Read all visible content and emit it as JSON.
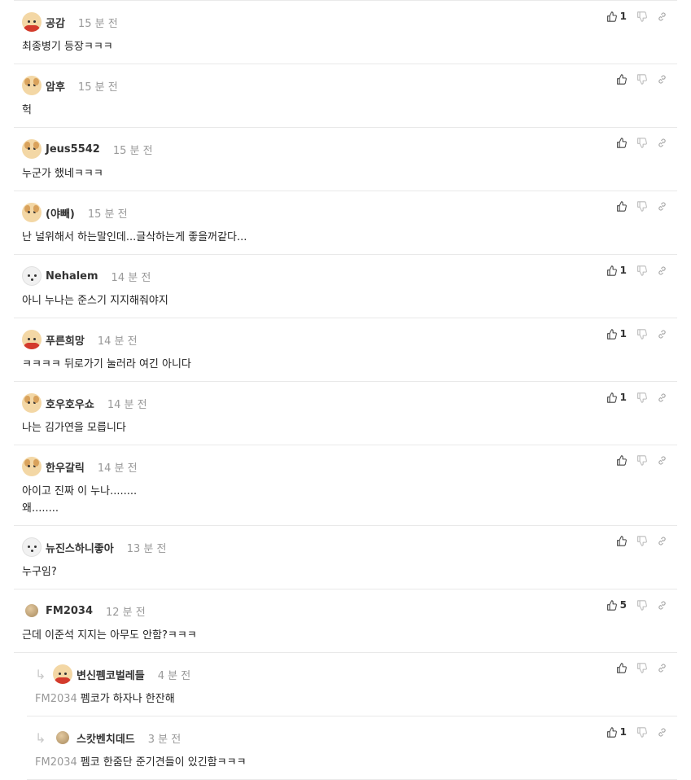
{
  "comments": [
    {
      "nick": "공감",
      "time": "15 분 전",
      "body": "최종병기 등장ㅋㅋㅋ",
      "avatar": "dog-red",
      "likes": "1",
      "reply": false
    },
    {
      "nick": "암후",
      "time": "15 분 전",
      "body": "헉",
      "avatar": "dog",
      "likes": "",
      "reply": false
    },
    {
      "nick": "Jeus5542",
      "time": "15 분 전",
      "body": "누군가 했네ㅋㅋㅋ",
      "avatar": "dog",
      "likes": "",
      "reply": false
    },
    {
      "nick": "(야빼)",
      "time": "15 분 전",
      "body": "난 널위해서 하는말인데...글삭하는게 좋을꺼같다...",
      "avatar": "dog",
      "likes": "",
      "reply": false
    },
    {
      "nick": "Nehalem",
      "time": "14 분 전",
      "body": "아니 누나는 준스기 지지해줘야지",
      "avatar": "white",
      "likes": "1",
      "reply": false
    },
    {
      "nick": "푸른희망",
      "time": "14 분 전",
      "body": "ㅋㅋㅋㅋ 뒤로가기 눌러라 여긴 아니다",
      "avatar": "dog-red",
      "likes": "1",
      "reply": false
    },
    {
      "nick": "호우호우쇼",
      "time": "14 분 전",
      "body": "나는 김가연을 모릅니다",
      "avatar": "dog",
      "likes": "1",
      "reply": false
    },
    {
      "nick": "한우갈릭",
      "time": "14 분 전",
      "body": "아이고 진짜 이 누나........\n왜........",
      "avatar": "dog",
      "likes": "",
      "reply": false
    },
    {
      "nick": "뉴진스하니좋아",
      "time": "13 분 전",
      "body": "누구임?",
      "avatar": "white",
      "likes": "",
      "reply": false
    },
    {
      "nick": "FM2034",
      "time": "12 분 전",
      "body": "근데 이준석 지지는 아무도 안함?ㅋㅋㅋ",
      "avatar": "disc",
      "likes": "5",
      "reply": false
    },
    {
      "nick": "변신펨코벌레들",
      "time": "4 분 전",
      "mention": "FM2034",
      "body": "펨코가 하자나 한잔해",
      "avatar": "dog-red",
      "likes": "",
      "reply": true
    },
    {
      "nick": "스캇벤치데드",
      "time": "3 분 전",
      "mention": "FM2034",
      "body": "펨코 한줌단 준기견들이 있긴함ㅋㅋㅋ",
      "avatar": "disc",
      "likes": "1",
      "reply": true
    }
  ],
  "icons": {
    "like": "thumbs-up-icon",
    "dislike": "thumbs-down-icon",
    "link": "link-icon",
    "reply_arrow": "reply-arrow-icon"
  },
  "reply_arrow_glyph": "↳"
}
